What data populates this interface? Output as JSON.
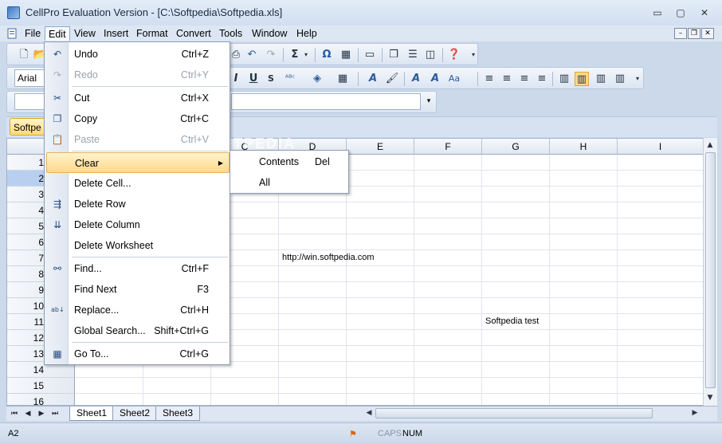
{
  "window": {
    "title": "CellPro Evaluation Version - [C:\\Softpedia\\Softpedia.xls]",
    "minimize": "▭",
    "maximize": "▢",
    "close": "✕"
  },
  "menubar": {
    "items": [
      "File",
      "Edit",
      "View",
      "Insert",
      "Format",
      "Convert",
      "Tools",
      "Window",
      "Help"
    ],
    "active": "Edit"
  },
  "formatting": {
    "font": "Arial"
  },
  "formula_bar": {
    "cell_ref_visible": "A",
    "value": ""
  },
  "doc_tab": {
    "label": "Softpe"
  },
  "edit_menu": {
    "items": [
      {
        "label": "Undo",
        "shortcut": "Ctrl+Z",
        "icon": "undo-icon",
        "enabled": true
      },
      {
        "label": "Redo",
        "shortcut": "Ctrl+Y",
        "icon": "redo-icon",
        "enabled": false
      },
      {
        "label": "Cut",
        "shortcut": "Ctrl+X",
        "icon": "scissors-icon",
        "enabled": true
      },
      {
        "label": "Copy",
        "shortcut": "Ctrl+C",
        "icon": "copy-icon",
        "enabled": true
      },
      {
        "label": "Paste",
        "shortcut": "Ctrl+V",
        "icon": "paste-icon",
        "enabled": false
      },
      {
        "label": "Clear",
        "shortcut": "",
        "icon": "",
        "enabled": true,
        "submenu": true,
        "highlighted": true
      },
      {
        "label": "Delete Cell...",
        "shortcut": "",
        "icon": "",
        "enabled": true
      },
      {
        "label": "Delete Row",
        "shortcut": "",
        "icon": "delete-row-icon",
        "enabled": true
      },
      {
        "label": "Delete Column",
        "shortcut": "",
        "icon": "delete-column-icon",
        "enabled": true
      },
      {
        "label": "Delete Worksheet",
        "shortcut": "",
        "icon": "",
        "enabled": true
      },
      {
        "label": "Find...",
        "shortcut": "Ctrl+F",
        "icon": "binoculars-icon",
        "enabled": true
      },
      {
        "label": "Find Next",
        "shortcut": "F3",
        "icon": "",
        "enabled": true
      },
      {
        "label": "Replace...",
        "shortcut": "Ctrl+H",
        "icon": "replace-icon",
        "enabled": true
      },
      {
        "label": "Global Search...",
        "shortcut": "Shift+Ctrl+G",
        "icon": "",
        "enabled": true
      },
      {
        "label": "Go To...",
        "shortcut": "Ctrl+G",
        "icon": "goto-icon",
        "enabled": true
      }
    ]
  },
  "clear_submenu": {
    "items": [
      {
        "label": "Contents",
        "shortcut": "Del"
      },
      {
        "label": "All",
        "shortcut": ""
      }
    ]
  },
  "sheet": {
    "columns": [
      "C",
      "D",
      "E",
      "F",
      "G",
      "H",
      "I"
    ],
    "rows": [
      "1",
      "2",
      "3",
      "4",
      "5",
      "6",
      "7",
      "8",
      "9",
      "10",
      "11",
      "12",
      "13",
      "14",
      "15",
      "16"
    ],
    "selected_row": "2",
    "cells": {
      "D7": "http://win.softpedia.com",
      "G11": "Softpedia test"
    }
  },
  "sheet_tabs": [
    "Sheet1",
    "Sheet2",
    "Sheet3"
  ],
  "active_sheet": "Sheet1",
  "statusbar": {
    "cell": "A2",
    "caps": "CAPS",
    "num": "NUM"
  },
  "watermark": "SOFTPEDIA"
}
